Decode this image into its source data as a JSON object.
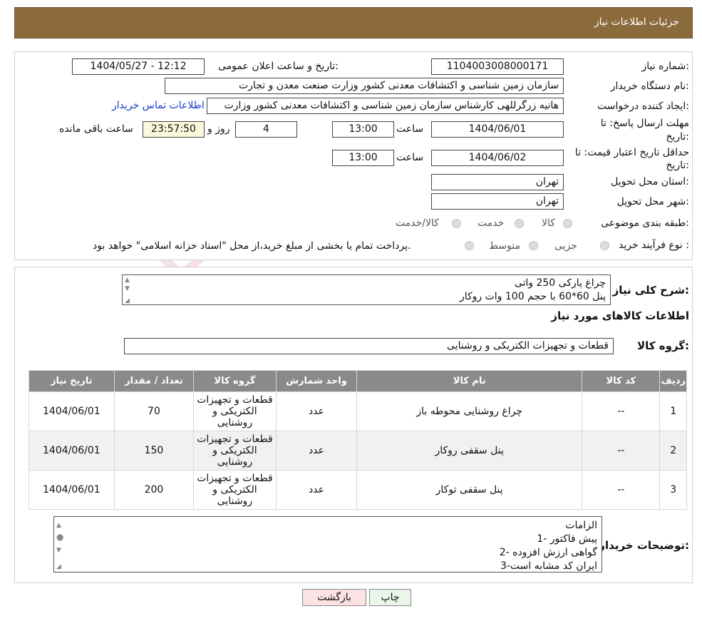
{
  "header": {
    "title": "جزئیات اطلاعات نیاز"
  },
  "form": {
    "need_number_label": "شماره نیاز:",
    "need_number": "1104003008000171",
    "announce_label": "تاریخ و ساعت اعلان عمومی:",
    "announce_value": "1404/05/27 - 12:12",
    "buyer_org_label": "نام دستگاه خریدار:",
    "buyer_org": "سازمان زمین شناسی و اکتشافات معدنی کشور وزارت صنعت معدن و تجارت",
    "creator_label": "ایجاد کننده درخواست:",
    "creator": "هانیه زرگرللهی کارشناس سازمان زمین شناسی و اکتشافات معدنی کشور وزارت",
    "contact_link": "اطلاعات تماس خریدار",
    "deadline_label_1": "مهلت ارسال پاسخ: تا",
    "deadline_label_2": "تاریخ:",
    "deadline_date": "1404/06/01",
    "time_label": "ساعت",
    "deadline_time": "13:00",
    "days_value": "4",
    "days_label": "روز و",
    "remaining_time": "23:57:50",
    "remaining_label": "ساعت باقی مانده",
    "validity_label_1": "حداقل تاریخ اعتبار قیمت: تا",
    "validity_label_2": "تاریخ:",
    "validity_date": "1404/06/02",
    "validity_time": "13:00",
    "province_label": "استان محل تحویل:",
    "province": "تهران",
    "city_label": "شهر محل تحویل:",
    "city": "تهران",
    "category_label": "طبقه بندی موضوعی:",
    "category_options": [
      "کالا",
      "خدمت",
      "کالا/خدمت"
    ],
    "process_label": "نوع فرآیند خرید :",
    "process_options": [
      "جزیی",
      "متوسط"
    ],
    "process_note": "پرداخت تمام یا بخشی از مبلغ خرید،از محل \"اسناد خزانه اسلامی\" خواهد بود."
  },
  "description": {
    "label": "شرح کلی نیاز:",
    "lines": [
      "چراغ پارکی 250 واتی",
      "پنل 60*60 با حجم 100 وات روکار"
    ]
  },
  "goods": {
    "section_title": "اطلاعات کالاهای مورد نیاز",
    "group_label": "گروه کالا:",
    "group_value": "قطعات و تجهیزات الکتریکی و روشنایی",
    "columns": [
      "ردیف",
      "کد کالا",
      "نام کالا",
      "واحد شمارش",
      "گروه کالا",
      "تعداد / مقدار",
      "تاریخ نیاز"
    ],
    "rows": [
      {
        "idx": "1",
        "code": "--",
        "name": "چراغ روشنایی محوطه باز",
        "unit": "عدد",
        "group": "قطعات و تجهیزات الکتریکی و روشنایی",
        "qty": "70",
        "date": "1404/06/01"
      },
      {
        "idx": "2",
        "code": "--",
        "name": "پنل سقفی روکار",
        "unit": "عدد",
        "group": "قطعات و تجهیزات الکتریکی و روشنایی",
        "qty": "150",
        "date": "1404/06/01"
      },
      {
        "idx": "3",
        "code": "--",
        "name": "پنل سقفی توکار",
        "unit": "عدد",
        "group": "قطعات و تجهیزات الکتریکی و روشنایی",
        "qty": "200",
        "date": "1404/06/01"
      }
    ]
  },
  "buyer_notes": {
    "label": "توضیحات خریدار:",
    "lines": [
      "الزامات",
      "1-  پیش فاکتور",
      "2- گواهی ارزش افزوده",
      "3-ایران کد مشابه است"
    ]
  },
  "buttons": {
    "print": "چاپ",
    "back": "بازگشت"
  },
  "watermark": {
    "text": "AriaTender.neT"
  },
  "colors": {
    "header_bg": "#8b6a3c",
    "table_header_bg": "#8a8a8a",
    "back_button_bg": "#fbe3e3",
    "print_button_bg": "#eaf6ea",
    "link": "#1a3cc8"
  }
}
